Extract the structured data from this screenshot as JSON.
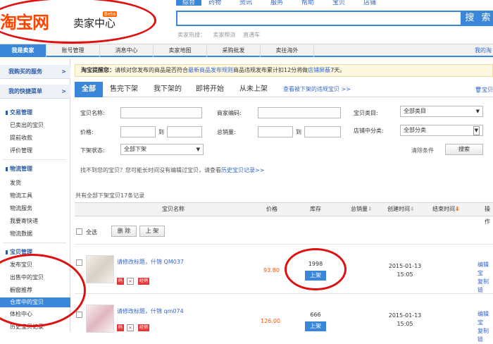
{
  "header": {
    "logo_text": "淘宝网",
    "logo_sub": "卖家中心",
    "beta": "Beta",
    "top_tabs": [
      "综合",
      "药物",
      "资讯",
      "服务",
      "帮助",
      "宝贝",
      "店铺"
    ],
    "search_button": "搜 索",
    "hot_label": "卖家热搜：",
    "hot_items": [
      "卖家帮派",
      "直通车"
    ]
  },
  "nav": {
    "items": [
      "我是卖家",
      "账号管理",
      "消息中心",
      "卖家地图",
      "采购批发",
      "卖往海外"
    ],
    "right": "我的淘"
  },
  "sidebar": {
    "heads": [
      "我购买的服务",
      "我的快捷菜单"
    ],
    "arrow": ">",
    "groups": [
      {
        "title": "交易管理",
        "items": [
          "已卖出的宝贝",
          "提前收款",
          "评价管理"
        ]
      },
      {
        "title": "物流管理",
        "items": [
          "发货",
          "物流工具",
          "物流服务",
          "我要寄快递",
          "物流数据"
        ]
      },
      {
        "title": "宝贝管理",
        "items": [
          "发布宝贝",
          "出售中的宝贝",
          "橱窗推荐",
          "仓库中的宝贝",
          "体检中心",
          "历史宝贝记录"
        ]
      }
    ]
  },
  "notice": {
    "label": "淘宝提醒您：",
    "text1": "请核对您发布的商品是否符合",
    "link1": "最新商品发布规则",
    "text2": "商品违规发布累计扣12分将做",
    "link2": "店铺屏蔽",
    "text3": "7天。"
  },
  "tabs": {
    "items": [
      "全部",
      "售完下架",
      "我下架的",
      "即将开始",
      "从未上架"
    ],
    "link": "查看被下架的违规宝贝 >>",
    "trash": "宝贝"
  },
  "filters": {
    "name_label": "宝贝名称:",
    "code_label": "商家编码:",
    "category_label": "宝贝类目:",
    "category_value": "全部类目",
    "price_label": "价格:",
    "to": "到",
    "sales_label": "总销量:",
    "shop_category_label": "店铺中分类:",
    "shop_category_value": "全部分类",
    "status_label": "下架状态:",
    "status_value": "全部下架",
    "clear": "清除条件",
    "search": "搜索"
  },
  "tip": {
    "text": "找不到您的宝贝？您可能长时间没有编辑过宝贝，请查看",
    "link": "历史宝贝记录>>"
  },
  "count_text": "共有全部下架宝贝17条记录",
  "table": {
    "headers": [
      "宝贝名称",
      "价格",
      "库存",
      "总销量",
      "创建时间",
      "结束时间",
      "操作"
    ],
    "select_all": "全选",
    "delete": "删 除",
    "list": "上 架",
    "rows": [
      {
        "title": "请修改标题，什锦 QM037",
        "price": "93.80",
        "stock": "1998",
        "action": "上架",
        "date": "2015-01-13",
        "time": "15:05",
        "op1": "编辑宝",
        "op2": "复制链",
        "badge_text": "码",
        "tag": "经销"
      },
      {
        "title": "请修改标题，什锦 qm074",
        "price": "126.00",
        "stock": "666",
        "action": "上架",
        "date": "2015-01-13",
        "time": "15:05",
        "op1": "编辑宝",
        "op2": "复制链",
        "badge_text": "码",
        "tag": "经销"
      }
    ]
  },
  "colors": {
    "accent": "#3a86d8",
    "price": "#ff5500",
    "annotation": "#e01010"
  }
}
